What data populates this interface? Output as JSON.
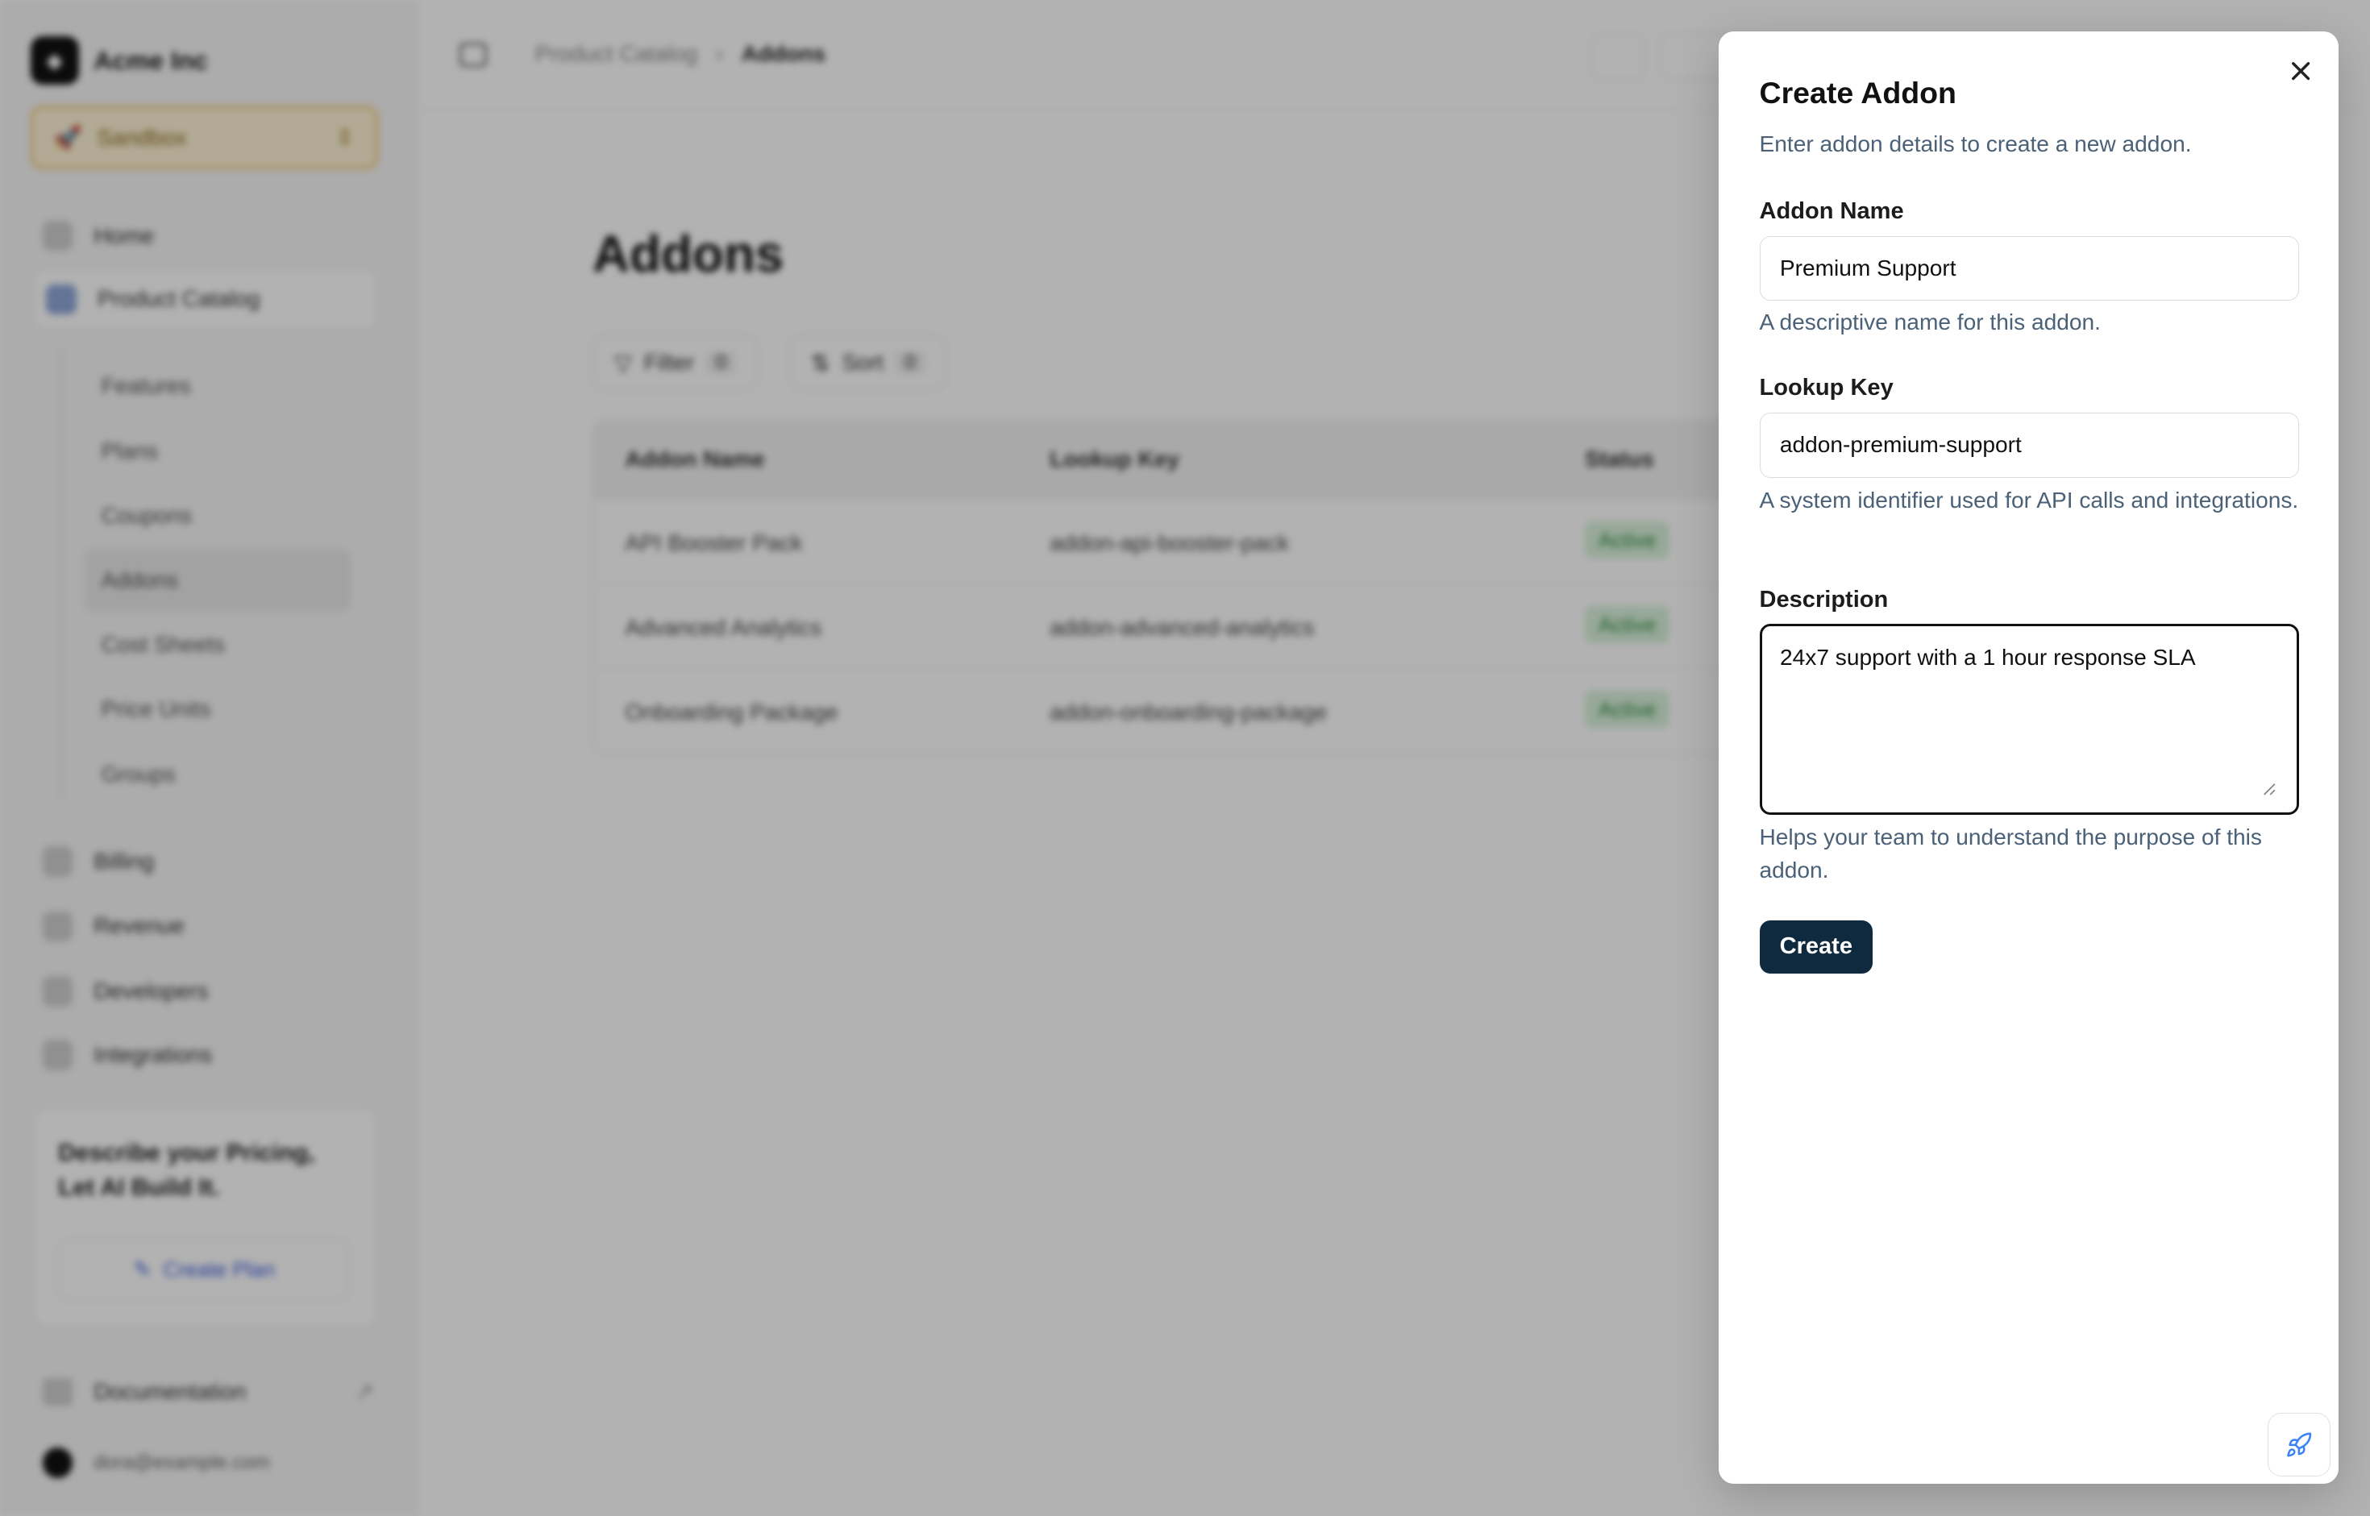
{
  "sidebar": {
    "org_name": "Acme Inc",
    "environment": "Sandbox",
    "nav": {
      "home": "Home",
      "product_catalog": "Product Catalog",
      "billing": "Billing",
      "revenue": "Revenue",
      "developers": "Developers",
      "integrations": "Integrations"
    },
    "sub_items": [
      "Features",
      "Plans",
      "Coupons",
      "Addons",
      "Cost Sheets",
      "Price Units",
      "Groups"
    ],
    "promo": {
      "title": "Describe your Pricing, Let AI Build It.",
      "button": "Create Plan"
    },
    "documentation": "Documentation",
    "user_email": "dora@example.com"
  },
  "breadcrumb": {
    "parent": "Product Catalog",
    "current": "Addons"
  },
  "page": {
    "title": "Addons",
    "filter_label": "Filter",
    "filter_count": "0",
    "sort_label": "Sort",
    "sort_count": "0",
    "columns": [
      "Addon Name",
      "Lookup Key",
      "Status"
    ],
    "rows": [
      {
        "name": "API Booster Pack",
        "key": "addon-api-booster-pack",
        "status": "Active"
      },
      {
        "name": "Advanced Analytics",
        "key": "addon-advanced-analytics",
        "status": "Active"
      },
      {
        "name": "Onboarding Package",
        "key": "addon-onboarding-package",
        "status": "Active"
      }
    ]
  },
  "dialog": {
    "title": "Create Addon",
    "subtitle": "Enter addon details to create a new addon.",
    "name_label": "Addon Name",
    "name_value": "Premium Support",
    "name_help": "A descriptive name for this addon.",
    "key_label": "Lookup Key",
    "key_value": "addon-premium-support",
    "key_help": "A system identifier used for API calls and integrations.",
    "desc_label": "Description",
    "desc_value": "24x7 support with a 1 hour response SLA",
    "desc_help": "Helps your team to understand the purpose of this addon.",
    "create_label": "Create"
  },
  "colors": {
    "primary_button": "#0f2a3f",
    "help_text": "#4a6178",
    "status_active": "#2f8a3e",
    "rocket_icon": "#3b82f6"
  }
}
